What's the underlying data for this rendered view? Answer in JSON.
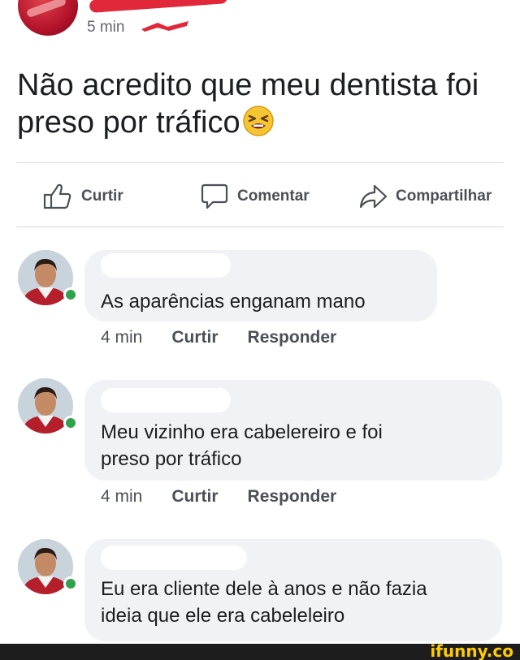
{
  "post": {
    "time": "5 min",
    "text": "Não acredito que meu dentista foi preso por tráfico",
    "emoji": "tired-face-emoji"
  },
  "actions": {
    "like": "Curtir",
    "comment": "Comentar",
    "share": "Compartilhar"
  },
  "comments": [
    {
      "text_lines": [
        "As aparências enganam mano"
      ],
      "time": "4 min",
      "like": "Curtir",
      "reply": "Responder"
    },
    {
      "text_lines": [
        "Meu vizinho era cabelereiro e foi",
        "preso por tráfico"
      ],
      "time": "4 min",
      "like": "Curtir",
      "reply": "Responder"
    },
    {
      "text_lines": [
        "Eu era cliente dele à anos e não fazia",
        "ideia que ele era cabeleleiro"
      ]
    }
  ],
  "watermark": "ifunny.co",
  "colors": {
    "bubble": "#f0f2f5",
    "online": "#31a24c",
    "redaction": "#e1283a",
    "watermark": "#ffcc00"
  }
}
